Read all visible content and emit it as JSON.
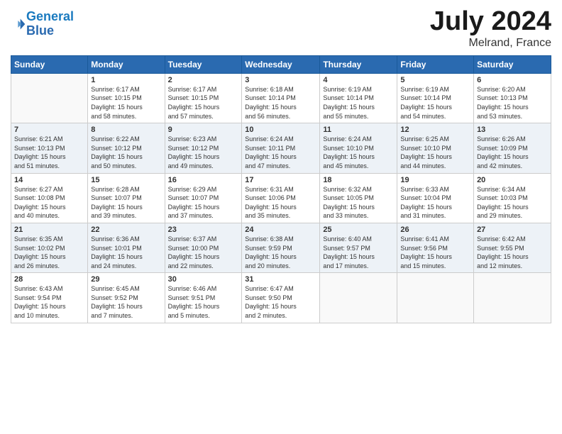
{
  "header": {
    "logo_line1": "General",
    "logo_line2": "Blue",
    "month": "July 2024",
    "location": "Melrand, France"
  },
  "days_of_week": [
    "Sunday",
    "Monday",
    "Tuesday",
    "Wednesday",
    "Thursday",
    "Friday",
    "Saturday"
  ],
  "weeks": [
    [
      {
        "day": "",
        "info": ""
      },
      {
        "day": "1",
        "info": "Sunrise: 6:17 AM\nSunset: 10:15 PM\nDaylight: 15 hours\nand 58 minutes."
      },
      {
        "day": "2",
        "info": "Sunrise: 6:17 AM\nSunset: 10:15 PM\nDaylight: 15 hours\nand 57 minutes."
      },
      {
        "day": "3",
        "info": "Sunrise: 6:18 AM\nSunset: 10:14 PM\nDaylight: 15 hours\nand 56 minutes."
      },
      {
        "day": "4",
        "info": "Sunrise: 6:19 AM\nSunset: 10:14 PM\nDaylight: 15 hours\nand 55 minutes."
      },
      {
        "day": "5",
        "info": "Sunrise: 6:19 AM\nSunset: 10:14 PM\nDaylight: 15 hours\nand 54 minutes."
      },
      {
        "day": "6",
        "info": "Sunrise: 6:20 AM\nSunset: 10:13 PM\nDaylight: 15 hours\nand 53 minutes."
      }
    ],
    [
      {
        "day": "7",
        "info": "Sunrise: 6:21 AM\nSunset: 10:13 PM\nDaylight: 15 hours\nand 51 minutes."
      },
      {
        "day": "8",
        "info": "Sunrise: 6:22 AM\nSunset: 10:12 PM\nDaylight: 15 hours\nand 50 minutes."
      },
      {
        "day": "9",
        "info": "Sunrise: 6:23 AM\nSunset: 10:12 PM\nDaylight: 15 hours\nand 49 minutes."
      },
      {
        "day": "10",
        "info": "Sunrise: 6:24 AM\nSunset: 10:11 PM\nDaylight: 15 hours\nand 47 minutes."
      },
      {
        "day": "11",
        "info": "Sunrise: 6:24 AM\nSunset: 10:10 PM\nDaylight: 15 hours\nand 45 minutes."
      },
      {
        "day": "12",
        "info": "Sunrise: 6:25 AM\nSunset: 10:10 PM\nDaylight: 15 hours\nand 44 minutes."
      },
      {
        "day": "13",
        "info": "Sunrise: 6:26 AM\nSunset: 10:09 PM\nDaylight: 15 hours\nand 42 minutes."
      }
    ],
    [
      {
        "day": "14",
        "info": "Sunrise: 6:27 AM\nSunset: 10:08 PM\nDaylight: 15 hours\nand 40 minutes."
      },
      {
        "day": "15",
        "info": "Sunrise: 6:28 AM\nSunset: 10:07 PM\nDaylight: 15 hours\nand 39 minutes."
      },
      {
        "day": "16",
        "info": "Sunrise: 6:29 AM\nSunset: 10:07 PM\nDaylight: 15 hours\nand 37 minutes."
      },
      {
        "day": "17",
        "info": "Sunrise: 6:31 AM\nSunset: 10:06 PM\nDaylight: 15 hours\nand 35 minutes."
      },
      {
        "day": "18",
        "info": "Sunrise: 6:32 AM\nSunset: 10:05 PM\nDaylight: 15 hours\nand 33 minutes."
      },
      {
        "day": "19",
        "info": "Sunrise: 6:33 AM\nSunset: 10:04 PM\nDaylight: 15 hours\nand 31 minutes."
      },
      {
        "day": "20",
        "info": "Sunrise: 6:34 AM\nSunset: 10:03 PM\nDaylight: 15 hours\nand 29 minutes."
      }
    ],
    [
      {
        "day": "21",
        "info": "Sunrise: 6:35 AM\nSunset: 10:02 PM\nDaylight: 15 hours\nand 26 minutes."
      },
      {
        "day": "22",
        "info": "Sunrise: 6:36 AM\nSunset: 10:01 PM\nDaylight: 15 hours\nand 24 minutes."
      },
      {
        "day": "23",
        "info": "Sunrise: 6:37 AM\nSunset: 10:00 PM\nDaylight: 15 hours\nand 22 minutes."
      },
      {
        "day": "24",
        "info": "Sunrise: 6:38 AM\nSunset: 9:59 PM\nDaylight: 15 hours\nand 20 minutes."
      },
      {
        "day": "25",
        "info": "Sunrise: 6:40 AM\nSunset: 9:57 PM\nDaylight: 15 hours\nand 17 minutes."
      },
      {
        "day": "26",
        "info": "Sunrise: 6:41 AM\nSunset: 9:56 PM\nDaylight: 15 hours\nand 15 minutes."
      },
      {
        "day": "27",
        "info": "Sunrise: 6:42 AM\nSunset: 9:55 PM\nDaylight: 15 hours\nand 12 minutes."
      }
    ],
    [
      {
        "day": "28",
        "info": "Sunrise: 6:43 AM\nSunset: 9:54 PM\nDaylight: 15 hours\nand 10 minutes."
      },
      {
        "day": "29",
        "info": "Sunrise: 6:45 AM\nSunset: 9:52 PM\nDaylight: 15 hours\nand 7 minutes."
      },
      {
        "day": "30",
        "info": "Sunrise: 6:46 AM\nSunset: 9:51 PM\nDaylight: 15 hours\nand 5 minutes."
      },
      {
        "day": "31",
        "info": "Sunrise: 6:47 AM\nSunset: 9:50 PM\nDaylight: 15 hours\nand 2 minutes."
      },
      {
        "day": "",
        "info": ""
      },
      {
        "day": "",
        "info": ""
      },
      {
        "day": "",
        "info": ""
      }
    ]
  ]
}
